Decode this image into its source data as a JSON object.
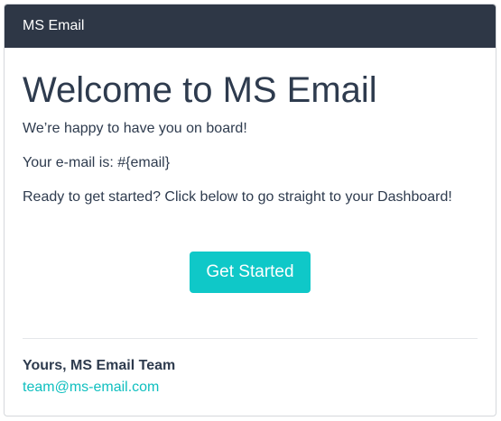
{
  "header": {
    "title": "MS Email",
    "background": "#2e3746"
  },
  "main": {
    "heading": "Welcome to MS Email",
    "intro": "We’re happy to have you on board!",
    "email_line": "Your e-mail is: #{email}",
    "cta_text": "Ready to get started? Click below to go straight to your Dashboard!",
    "button_label": "Get Started",
    "button_color": "#0fc8c8"
  },
  "footer": {
    "signature": "Yours, MS Email Team",
    "contact_email": "team@ms-email.com",
    "link_color": "#0fbfbf"
  }
}
